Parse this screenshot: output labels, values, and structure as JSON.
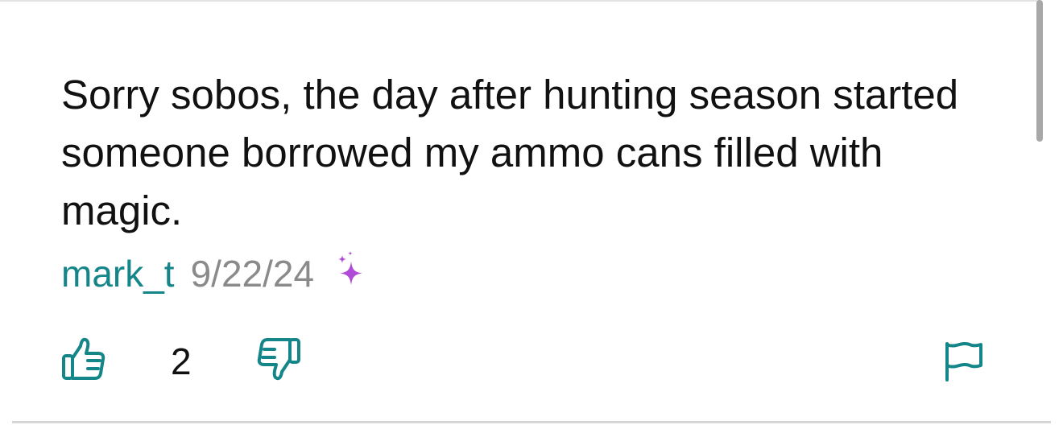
{
  "comment": {
    "text": "Sorry sobos, the day after hunting season started someone borrowed my ammo cans filled with magic.",
    "author": "mark_t",
    "date": "9/22/24",
    "badge_icon": "sparkle-icon",
    "vote_count": "2"
  },
  "icons": {
    "upvote": "thumbs-up-icon",
    "downvote": "thumbs-down-icon",
    "report": "flag-icon"
  },
  "colors": {
    "accent": "#14868a",
    "date_gray": "#8a8a8a",
    "sparkle_purple": "#b04bd8",
    "text": "#111111"
  }
}
